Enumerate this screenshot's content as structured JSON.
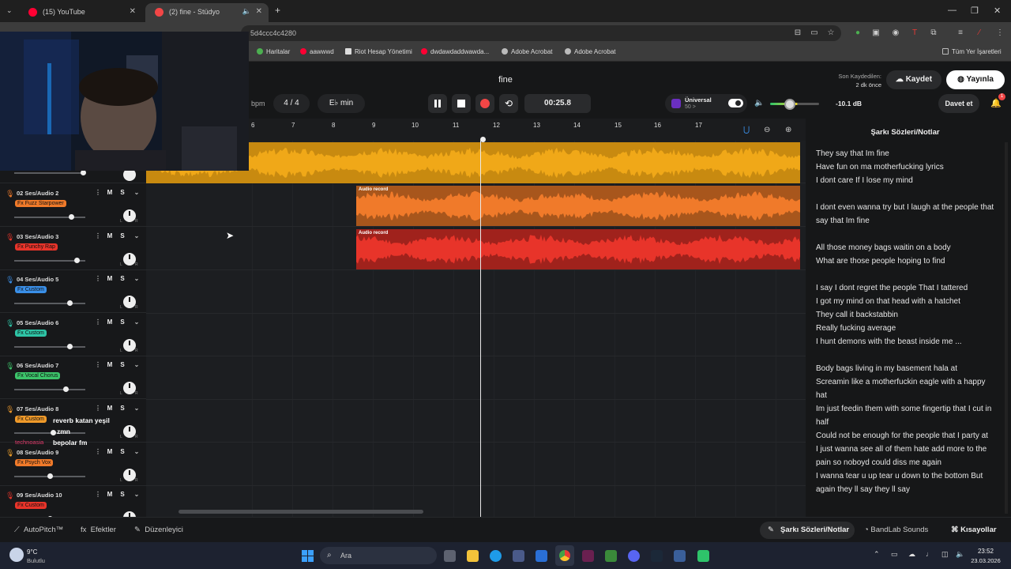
{
  "browser": {
    "tabs": [
      {
        "label": "(15) YouTube",
        "color": "#ff0033"
      },
      {
        "label": "(2) fine - Stüdyo",
        "color": "#f24646"
      }
    ],
    "url": "5d4ccc4c4280",
    "bookmarks": [
      "Haritalar",
      "aawwwd",
      "Riot Hesap Yönetimi",
      "dwdawdaddwawda...",
      "Adobe Acrobat",
      "Adobe Acrobat"
    ],
    "all_bookmarks": "Tüm Yer İşaretleri"
  },
  "app": {
    "song_title": "fine",
    "bpm_label": "bpm",
    "time_sig": "4 / 4",
    "key": "E♭ min",
    "time_display": "00:25.8",
    "universal_label": "Üniversal",
    "universal_sub": "50 >",
    "volume_db": "-10.1 dB",
    "last_saved_label": "Son Kaydedilen:",
    "last_saved_value": "2 dk önce",
    "save_label": "Kaydet",
    "publish_label": "Yayınla",
    "invite_label": "Davet et",
    "notification_count": "1",
    "accent": "#f24646"
  },
  "ruler": [
    "6",
    "7",
    "8",
    "9",
    "10",
    "11",
    "12",
    "13",
    "14",
    "15",
    "16",
    "17"
  ],
  "tracks": [
    {
      "name": "02  Ses/Audio 2",
      "fx": "Fx Fuzz Starpower",
      "fx_color": "#f07a2a",
      "icon_color": "#f07a2a",
      "volume": 0.8
    },
    {
      "name": "03  Ses/Audio 3",
      "fx": "Fx Punchy Rap",
      "fx_color": "#e8342a",
      "icon_color": "#e8342a",
      "volume": 0.88
    },
    {
      "name": "04  Ses/Audio 5",
      "fx": "Fx Custom",
      "fx_color": "#3a8fe8",
      "icon_color": "#3a8fe8",
      "volume": 0.78
    },
    {
      "name": "05  Ses/Audio 6",
      "fx": "Fx Custom",
      "fx_color": "#2ec4a6",
      "icon_color": "#2ec4a6",
      "volume": 0.78
    },
    {
      "name": "06  Ses/Audio 7",
      "fx": "Fx Vocal Chorus",
      "fx_color": "#3cc46a",
      "icon_color": "#3cc46a",
      "volume": 0.73
    },
    {
      "name": "07  Ses/Audio 8",
      "fx": "Fx Custom",
      "fx_color": "#f09a2a",
      "icon_color": "#f09a2a",
      "volume": 0.55
    },
    {
      "name": "08  Ses/Audio 9",
      "fx": "Fx Psych Vox",
      "fx_color": "#f07a2a",
      "icon_color": "#f0a02a",
      "volume": 0.5
    },
    {
      "name": "09  Ses/Audio 10",
      "fx": "Fx Custom",
      "fx_color": "#e8342a",
      "icon_color": "#e8342a",
      "volume": 0.5
    }
  ],
  "clips": {
    "audio_record_label": "Audio record",
    "master_color": "#f0a818",
    "track2_color": "#f07a2a",
    "track3_color": "#e8342a"
  },
  "chat_overlay": [
    "reverb katan yeşil",
    "zmn",
    "bepolar fm"
  ],
  "chat_users": [
    "technoasia"
  ],
  "lyrics": {
    "title": "Şarkı Sözleri/Notlar",
    "text": "They say that Im fine\nHave fun on ma motherfucking lyrics\nI dont care If I lose my mind\n\nI dont even wanna try but I laugh at the people that say that Im fine\n\nAll those money bags waitin on a body\nWhat are those people hoping to find\n\nI say I dont regret the people That I tattered\nI got my mind on that head with a hatchet\nThey call it backstabbin\nReally fucking average\nI hunt demons with the beast inside me ...\n\nBody bags living in my basement hala at\nScreamin like a motherfuckin eagle with a happy hat\nIm just feedin them with some fingertip that I cut in half\nCould not be enough for the people that I party at\nI just wanna see all of them hate add more to the pain so noboyd could diss me again\nI wanna tear u up tear u down to the bottom But again they ll say they ll say"
  },
  "bottom": {
    "autopitch": "AutoPitch™",
    "effects": "Efektler",
    "editor": "Düzenleyici",
    "lyrics_tab": "Şarkı Sözleri/Notlar",
    "sounds": "BandLab Sounds",
    "shortcuts": "Kısayollar"
  },
  "taskbar": {
    "weather_temp": "9°C",
    "weather_text": "Bulutlu",
    "search": "Ara",
    "time": "23:52",
    "date": "23.03.2026"
  }
}
